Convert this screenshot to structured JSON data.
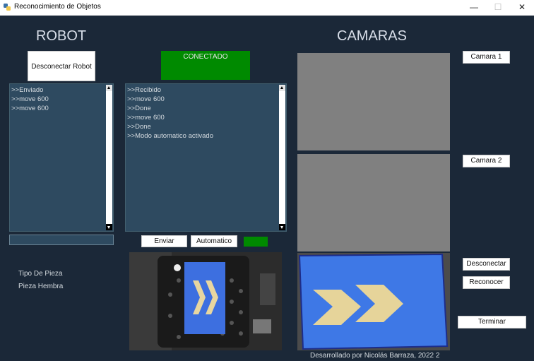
{
  "window": {
    "title": "Reconocimiento de Objetos",
    "minimize_glyph": "—",
    "maximize_glyph": "☐",
    "close_glyph": "✕"
  },
  "robot": {
    "heading": "ROBOT",
    "disconnect_button": "Desconectar Robot",
    "status_text": "CONECTADO",
    "status_color": "#008a00",
    "sent_log": ">>Enviado\n>>move 600\n>>move 600",
    "received_log": ">>Recibido\n>>move 600\n>>Done\n>>move 600\n>>Done\n>>Modo automatico activado",
    "command_input": "",
    "send_button": "Enviar",
    "auto_button": "Automatico",
    "auto_indicator_color": "#008a00",
    "piece_type_label": "Tipo De Pieza",
    "piece_type_value": "Pieza Hembra"
  },
  "cameras": {
    "heading": "CAMARAS",
    "camera1_button": "Camara 1",
    "camera2_button": "Camara 2",
    "disconnect_button": "Desconectar",
    "recognize_button": "Reconocer",
    "finish_button": "Terminar"
  },
  "footer": {
    "credit": "Desarrollado por Nicolás Barraza, 2022 2"
  }
}
